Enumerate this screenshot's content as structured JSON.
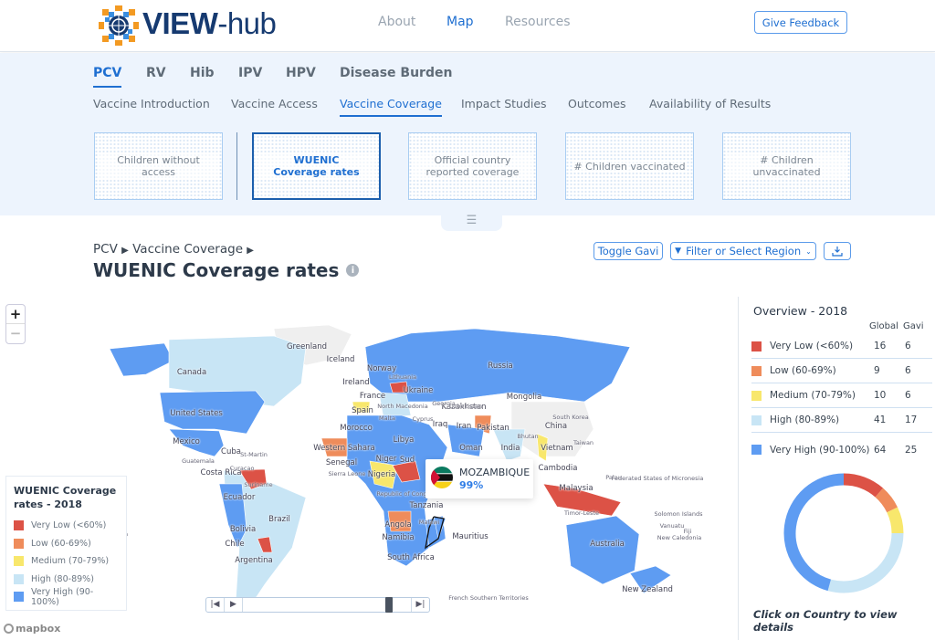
{
  "header": {
    "logo": "VIEW-hub",
    "nav": [
      {
        "label": "About"
      },
      {
        "label": "Map",
        "active": true
      },
      {
        "label": "Resources"
      }
    ],
    "feedback": "Give Feedback"
  },
  "vaccine_tabs": [
    "PCV",
    "RV",
    "Hib",
    "IPV",
    "HPV",
    "Disease Burden"
  ],
  "section_tabs": [
    "Vaccine Introduction",
    "Vaccine Access",
    "Vaccine Coverage",
    "Impact Studies",
    "Outcomes",
    "Availability of Results"
  ],
  "cards": [
    "Children without access",
    "WUENIC Coverage rates",
    "Official country reported coverage",
    "# Children vaccinated",
    "# Children unvaccinated"
  ],
  "breadcrumb": {
    "a": "PCV",
    "b": "Vaccine Coverage"
  },
  "title": "WUENIC Coverage rates",
  "toolbar": {
    "toggle": "Toggle Gavi",
    "filter": "Filter or Select Region"
  },
  "colors": {
    "very_low": "#dc5246",
    "low": "#ef8c5b",
    "medium": "#f8e76c",
    "high": "#c8e5f5",
    "very_high": "#5e9cf2",
    "accent": "#1f6fd1",
    "no_data": "#efefef"
  },
  "legend": {
    "title": "WUENIC Coverage rates - 2018",
    "items": [
      "Very Low (<60%)",
      "Low (60-69%)",
      "Medium (70-79%)",
      "High (80-89%)",
      "Very High (90-100%)"
    ]
  },
  "tooltip": {
    "country": "MOZAMBIQUE",
    "value": "99%"
  },
  "map_labels": [
    "Greenland",
    "Iceland",
    "Canada",
    "Norway",
    "Ireland",
    "Lithuania",
    "Russia",
    "Ukraine",
    "France",
    "Kazakhstan",
    "Mongolia",
    "Spain",
    "North Macedonia",
    "Georgia",
    "Uzbekistan",
    "Malta",
    "Cyprus",
    "South Korea",
    "United States",
    "Morocco",
    "Iraq",
    "Iran",
    "Pakistan",
    "China",
    "Bhutan",
    "Libya",
    "Taiwan",
    "Mexico",
    "Cuba",
    "St-Martin",
    "Western Sahara",
    "Oman",
    "India",
    "Vietnam",
    "Guatemala",
    "Niger",
    "Sud",
    "Senegal",
    "Cambodia",
    "Costa Rica",
    "Curacao",
    "Sierra Leone",
    "Nigeria",
    "Palau",
    "Federated States of Micronesia",
    "Suriname",
    "Malaysia",
    "Ecuador",
    "Republic of Congo",
    "Tanzania",
    "Timor-Leste",
    "Solomon Islands",
    "Malawi",
    "Brazil",
    "Bolivia",
    "Angola",
    "Vanuatu",
    "Fiji",
    "Mauritius",
    "New Caledonia",
    "Chile",
    "Namibia",
    "Australia",
    "French Polynesia",
    "South Africa",
    "Argentina",
    "New Zealand",
    "French Southern Territories"
  ],
  "attribution": "mapbox",
  "overview": {
    "title": "Overview - 2018",
    "col_global": "Global",
    "col_gavi": "Gavi",
    "rows": [
      {
        "label": "Very Low (<60%)",
        "global": 16,
        "gavi": 6
      },
      {
        "label": "Low (60-69%)",
        "global": 9,
        "gavi": 6
      },
      {
        "label": "Medium (70-79%)",
        "global": 10,
        "gavi": 6
      },
      {
        "label": "High (80-89%)",
        "global": 41,
        "gavi": 17
      },
      {
        "label": "Very High (90-100%)",
        "global": 64,
        "gavi": 25
      }
    ],
    "footer": "Click on Country to view details"
  }
}
